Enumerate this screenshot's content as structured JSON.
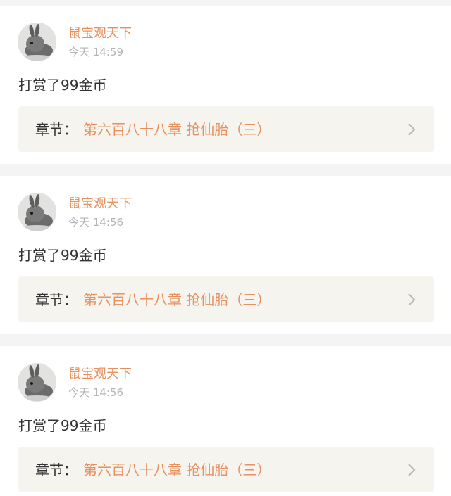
{
  "colors": {
    "accent": "#e8905e",
    "text": "#333333",
    "muted": "#b5b5b5",
    "chapter_bg": "#f5f4ef",
    "page_bg": "#f4f4f4"
  },
  "entries": [
    {
      "username": "鼠宝观天下",
      "time": "今天 14:59",
      "message": "打赏了99金币",
      "chapter_prefix": "章节：",
      "chapter_title": "第六百八十八章 抢仙胎（三）",
      "avatar_icon": "rabbit-avatar",
      "chevron_icon": "chevron-right-icon"
    },
    {
      "username": "鼠宝观天下",
      "time": "今天 14:56",
      "message": "打赏了99金币",
      "chapter_prefix": "章节：",
      "chapter_title": "第六百八十八章 抢仙胎（三）",
      "avatar_icon": "rabbit-avatar",
      "chevron_icon": "chevron-right-icon"
    },
    {
      "username": "鼠宝观天下",
      "time": "今天 14:56",
      "message": "打赏了99金币",
      "chapter_prefix": "章节：",
      "chapter_title": "第六百八十八章 抢仙胎（三）",
      "avatar_icon": "rabbit-avatar",
      "chevron_icon": "chevron-right-icon"
    }
  ]
}
